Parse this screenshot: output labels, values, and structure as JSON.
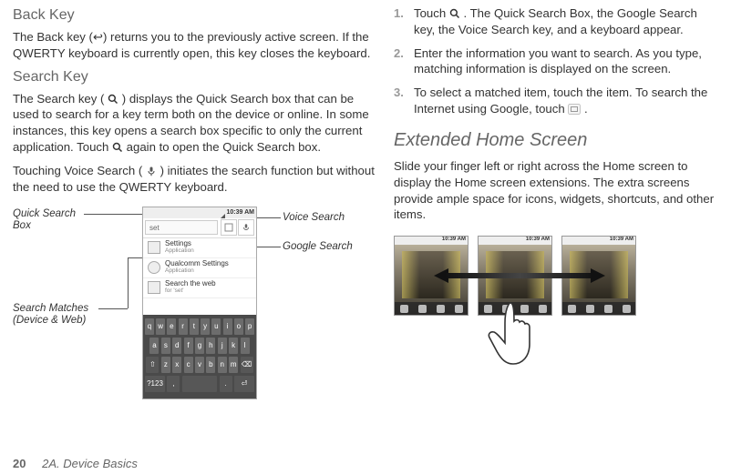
{
  "left": {
    "back_key_h": "Back Key",
    "back_key_p": "The Back key (↩) returns you to the previously active screen. If the QWERTY keyboard is currently open, this key closes the keyboard.",
    "search_key_h": "Search Key",
    "search_key_p1_a": "The Search key (",
    "search_key_p1_b": ") displays the Quick Search box that can be used to search for a key term both on the device or online. In some instances, this key opens a search box specific to only the current application. Touch ",
    "search_key_p1_c": " again to open the Quick Search box.",
    "search_key_p2_a": "Touching Voice Search (",
    "search_key_p2_b": ") initiates the search function but without the need to use the QWERTY keyboard.",
    "callouts": {
      "qsb": "Quick Search\nBox",
      "voice": "Voice Search",
      "google": "Google Search",
      "matches": "Search Matches\n(Device & Web)"
    },
    "phone": {
      "time": "10:39 AM",
      "field_text": "set",
      "results": [
        {
          "title": "Settings",
          "sub": "Application",
          "round": false
        },
        {
          "title": "Qualcomm Settings",
          "sub": "Application",
          "round": true
        },
        {
          "title": "Search the web",
          "sub": "for 'set'",
          "round": false
        }
      ],
      "rows": [
        [
          "q",
          "w",
          "e",
          "r",
          "t",
          "y",
          "u",
          "i",
          "o",
          "p"
        ],
        [
          "a",
          "s",
          "d",
          "f",
          "g",
          "h",
          "j",
          "k",
          "l"
        ],
        [
          "⇧",
          "z",
          "x",
          "c",
          "v",
          "b",
          "n",
          "m",
          "⌫"
        ],
        [
          "?123",
          ",",
          "␣",
          ".",
          "⏎"
        ]
      ]
    }
  },
  "right": {
    "step1_a": "Touch ",
    "step1_b": ". The Quick Search Box, the Google Search key, the Voice Search key, and a keyboard appear.",
    "step2": "Enter the information you want to search. As you type, matching information is displayed on the screen.",
    "step3_a": "To select a matched item, touch the item. To search the Internet using Google, touch ",
    "step3_b": ".",
    "ext_h": "Extended Home Screen",
    "ext_p": "Slide your finger left or right across the Home screen to display the Home screen extensions. The extra screens provide ample space for icons, widgets, shortcuts, and other items.",
    "panel_time": "10:39 AM"
  },
  "footer": {
    "page": "20",
    "section": "2A. Device Basics"
  },
  "icons": {
    "mag": "🔍",
    "mic": "🎙",
    "goog": "▢"
  }
}
